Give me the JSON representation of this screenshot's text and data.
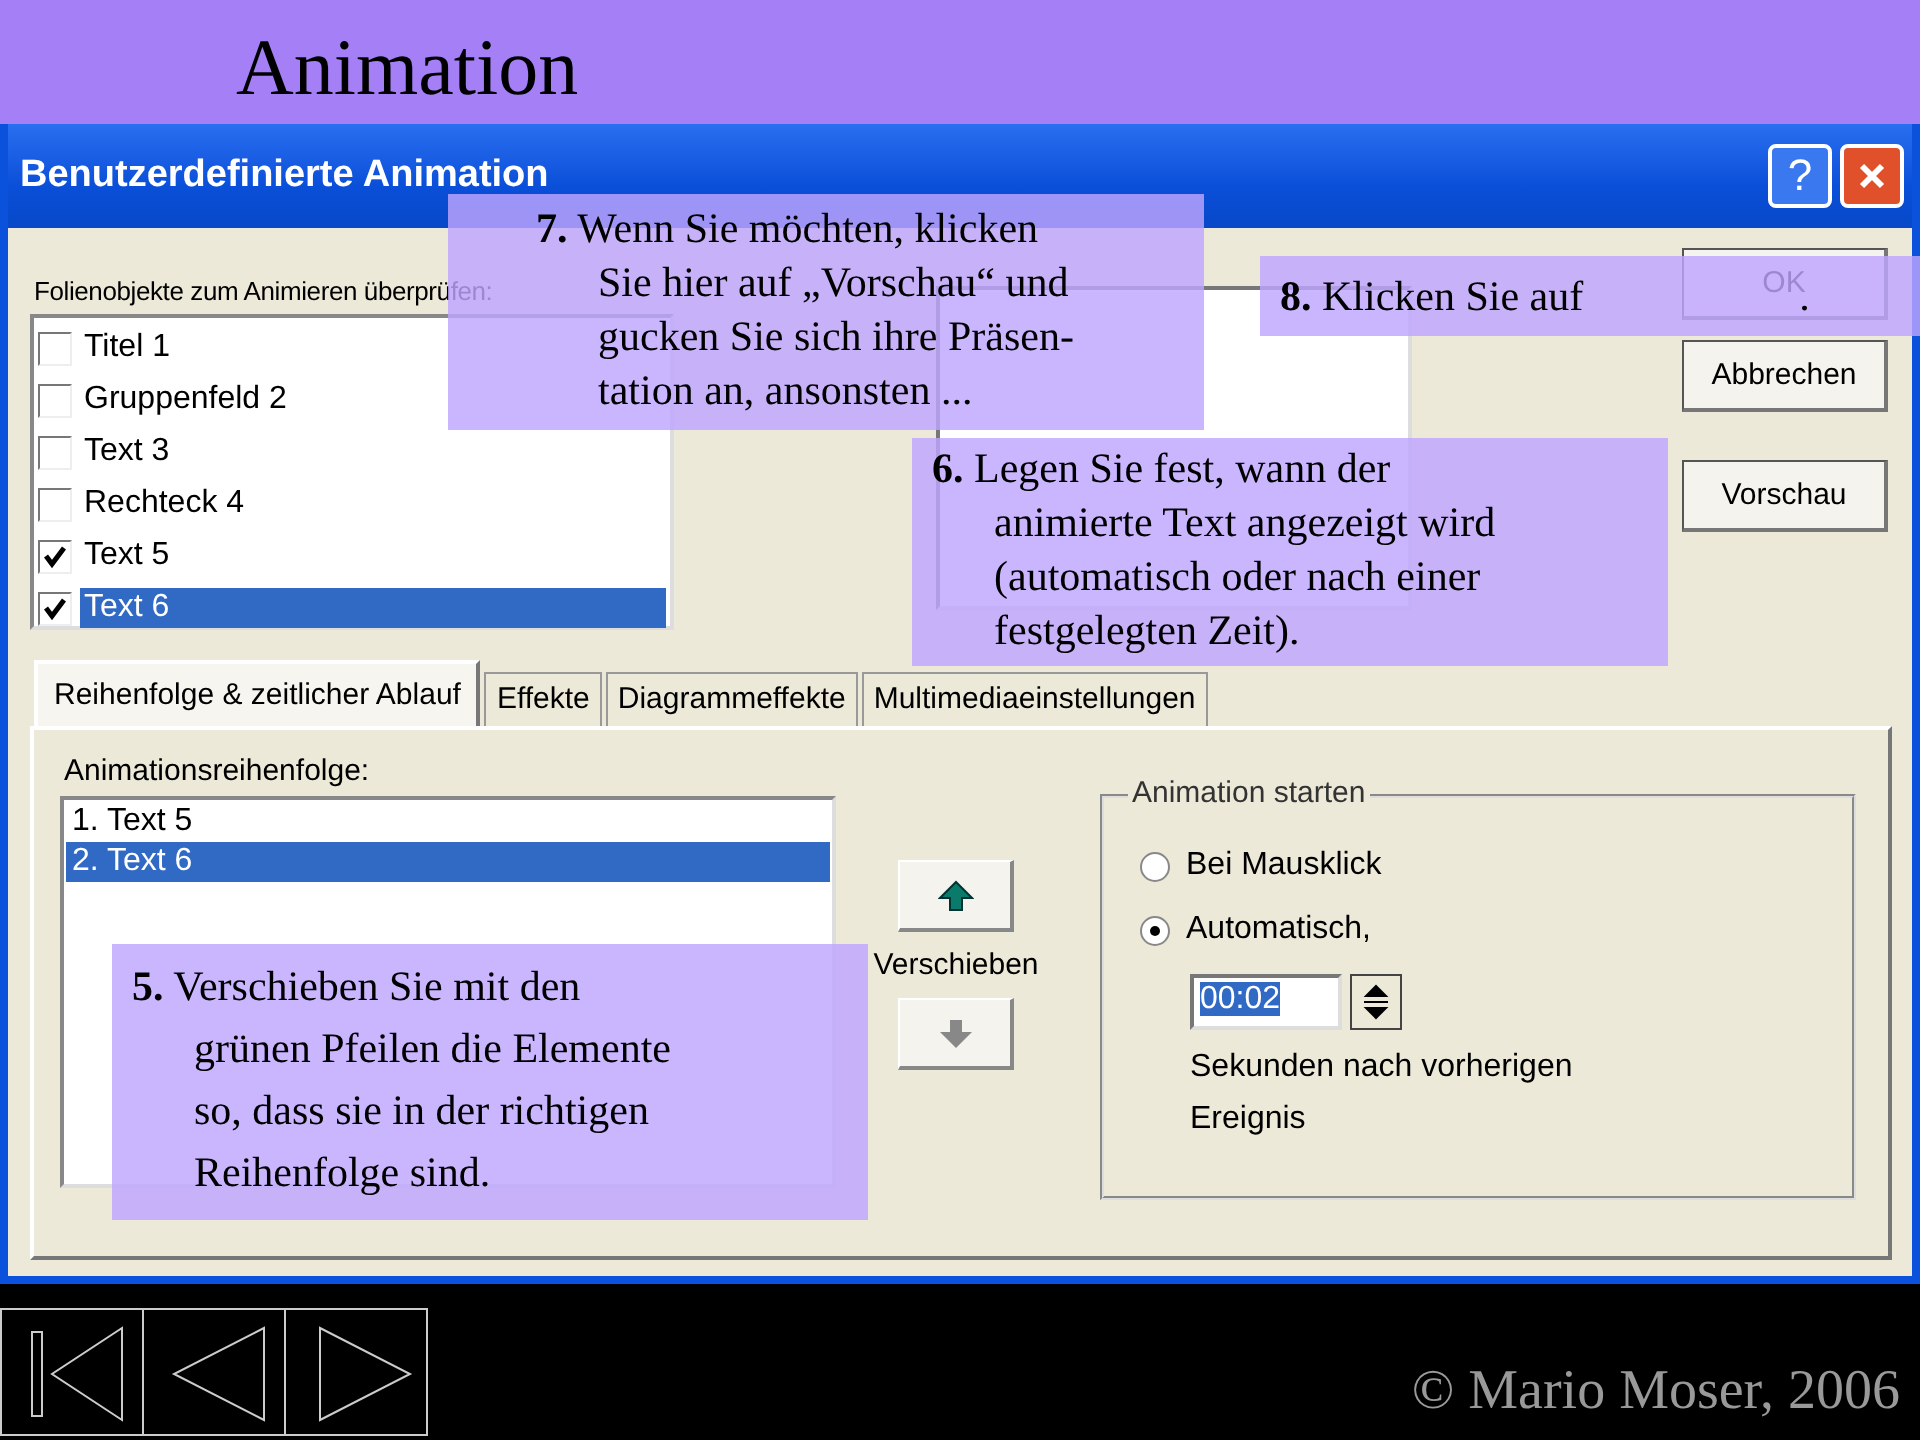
{
  "slide": {
    "title": "Animation"
  },
  "dialog": {
    "title": "Benutzerdefinierte Animation",
    "help_button": "?",
    "objects_label": "Folienobjekte zum Animieren überprüfen:",
    "objects": [
      {
        "label": "Titel 1",
        "checked": false,
        "selected": false
      },
      {
        "label": "Gruppenfeld 2",
        "checked": false,
        "selected": false
      },
      {
        "label": "Text 3",
        "checked": false,
        "selected": false
      },
      {
        "label": "Rechteck 4",
        "checked": false,
        "selected": false
      },
      {
        "label": "Text 5",
        "checked": true,
        "selected": false
      },
      {
        "label": "Text 6",
        "checked": true,
        "selected": true
      }
    ],
    "buttons": [
      "OK",
      "Abbrechen",
      "Vorschau"
    ],
    "tabs": [
      {
        "label": "Reihenfolge & zeitlicher Ablauf",
        "selected": true
      },
      {
        "label": "Effekte",
        "selected": false
      },
      {
        "label": "Diagrammeffekte",
        "selected": false
      },
      {
        "label": "Multimediaeinstellungen",
        "selected": false
      }
    ],
    "order_label": "Animationsreihenfolge:",
    "order": [
      {
        "label": "1. Text 5",
        "selected": false
      },
      {
        "label": "2. Text 6",
        "selected": true
      }
    ],
    "move_label": "Verschieben",
    "start_group": {
      "title": "Animation starten",
      "options": [
        {
          "label": "Bei Mausklick",
          "selected": false
        },
        {
          "label": "Automatisch,",
          "selected": true
        }
      ],
      "delay": "00:02",
      "delay_note": "Sekunden nach vorherigen\nEreignis"
    }
  },
  "callouts": [
    {
      "number": "7.",
      "text": "Wenn Sie möchten, klicken\nSie hier auf „Vorschau“ und\ngucken Sie sich ihre Präsen-\ntation an, ansonsten ..."
    },
    {
      "number": "8.",
      "text": "Klicken Sie auf",
      "suffix": "."
    },
    {
      "number": "6.",
      "text": "Legen Sie fest, wann der\nanimierte Text angezeigt wird\n(automatisch oder nach einer\nfestgelegten Zeit)."
    },
    {
      "number": "5.",
      "text": "Verschieben Sie mit den\ngrünen Pfeilen die Elemente\nso, dass sie in der richtigen\nReihenfolge sind."
    }
  ],
  "footer": {
    "copyright": "© Mario Moser, 2006"
  }
}
